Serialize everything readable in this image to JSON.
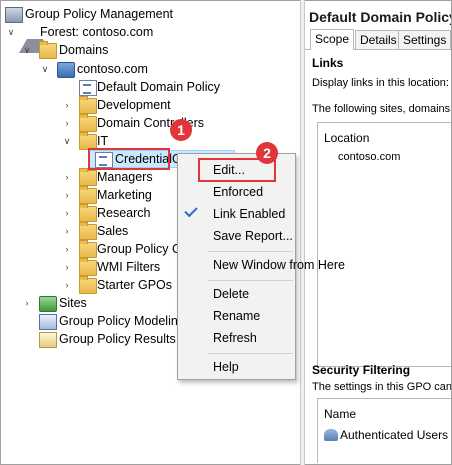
{
  "tree": {
    "root": "Group Policy Management",
    "forest": "Forest: contoso.com",
    "domains": "Domains",
    "domain": "contoso.com",
    "default_policy": "Default Domain Policy",
    "development": "Development",
    "domain_controllers": "Domain Controllers",
    "it": "IT",
    "credential_gpo": "CredentialGuardGPO",
    "managers": "Managers",
    "marketing": "Marketing",
    "research": "Research",
    "sales": "Sales",
    "group_policy_objects": "Group Policy Objects",
    "wmi_filters": "WMI Filters",
    "starter_gpos": "Starter GPOs",
    "sites": "Sites",
    "modeling": "Group Policy Modeling",
    "results": "Group Policy Results"
  },
  "right_pane": {
    "title": "Default Domain Policy",
    "tabs": [
      "Scope",
      "Details",
      "Settings"
    ],
    "links_heading": "Links",
    "links_desc": "Display links in this location:",
    "links_note": "The following sites, domains, and OUs are linked to this GPO:",
    "location_header": "Location",
    "location_value": "contoso.com",
    "filtering_heading": "Security Filtering",
    "filtering_note": "The settings in this GPO can only apply to the following groups, users, and computers:",
    "name_header": "Name",
    "name_value": "Authenticated Users"
  },
  "context_menu": {
    "edit": "Edit...",
    "enforced": "Enforced",
    "link_enabled": "Link Enabled",
    "save_report": "Save Report...",
    "new_window": "New Window from Here",
    "delete": "Delete",
    "rename": "Rename",
    "refresh": "Refresh",
    "help": "Help"
  },
  "callouts": {
    "one": "1",
    "two": "2"
  },
  "colors": {
    "callout_red": "#e0353b",
    "selection": "#cce8ff",
    "check_blue": "#2b6cc4"
  }
}
